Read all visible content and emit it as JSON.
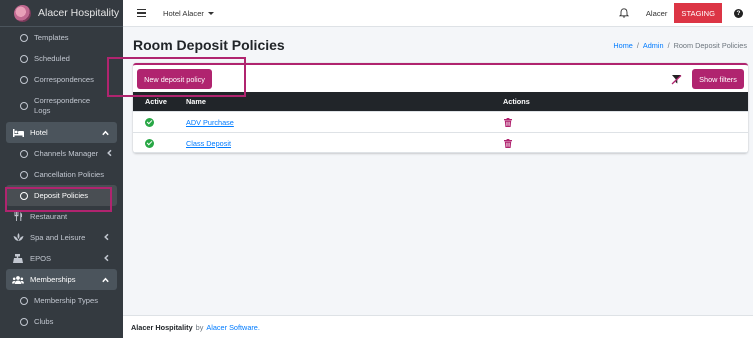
{
  "brand": {
    "name": "Alacer Hospitality"
  },
  "sidebar": {
    "items_top": [
      {
        "label": "Templates"
      },
      {
        "label": "Scheduled"
      },
      {
        "label": "Correspondences"
      },
      {
        "label": "Correspondence Logs"
      }
    ],
    "hotel": {
      "label": "Hotel",
      "icon": "bed-icon",
      "children": [
        {
          "label": "Channels Manager"
        },
        {
          "label": "Cancellation Policies"
        },
        {
          "label": "Deposit Policies"
        }
      ]
    },
    "sections": [
      {
        "label": "Restaurant",
        "icon": "utensils-icon"
      },
      {
        "label": "Spa and Leisure",
        "icon": "spa-icon"
      },
      {
        "label": "EPOS",
        "icon": "cash-register-icon"
      }
    ],
    "memberships": {
      "label": "Memberships",
      "icon": "users-icon",
      "children": [
        {
          "label": "Membership Types"
        },
        {
          "label": "Clubs"
        }
      ]
    }
  },
  "topbar": {
    "hotel_select": "Hotel Alacer",
    "username": "Alacer",
    "environment_badge": "STAGING",
    "help_glyph": "?"
  },
  "page": {
    "title": "Room Deposit Policies",
    "breadcrumb": [
      "Home",
      "Admin",
      "Room Deposit Policies"
    ],
    "breadcrumb_sep": "/"
  },
  "card": {
    "new_button": "New deposit policy",
    "filters_button": "Show filters",
    "columns": [
      "Active",
      "Name",
      "Actions"
    ],
    "rows": [
      {
        "active": true,
        "name": "ADV Purchase"
      },
      {
        "active": true,
        "name": "Class Deposit"
      }
    ]
  },
  "footer": {
    "company": "Alacer Hospitality",
    "by": "by",
    "link": "Alacer Software."
  },
  "colors": {
    "accent": "#b0246f",
    "sidebar_bg": "#343a40",
    "staging": "#dc3545",
    "link": "#007bff",
    "success": "#28a745"
  }
}
